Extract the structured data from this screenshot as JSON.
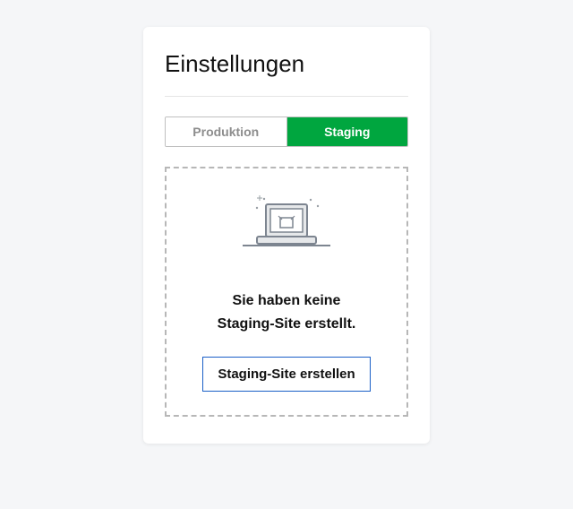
{
  "page": {
    "title": "Einstellungen"
  },
  "tabs": {
    "production": "Produktion",
    "staging": "Staging"
  },
  "empty_state": {
    "message_line1": "Sie haben keine",
    "message_line2": "Staging-Site erstellt.",
    "cta": "Staging-Site erstellen"
  }
}
